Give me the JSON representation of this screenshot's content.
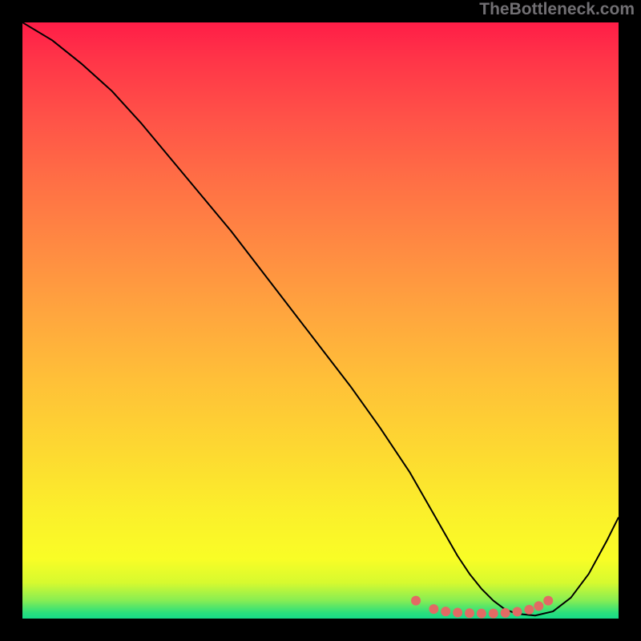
{
  "watermark": "TheBottleneck.com",
  "chart_data": {
    "type": "line",
    "title": "",
    "xlabel": "",
    "ylabel": "",
    "xlim": [
      0,
      100
    ],
    "ylim": [
      0,
      100
    ],
    "grid": false,
    "series": [
      {
        "name": "bottleneck-curve",
        "color": "#000000",
        "x": [
          0,
          5,
          10,
          15,
          20,
          25,
          30,
          35,
          40,
          45,
          50,
          55,
          60,
          65,
          67,
          69,
          71,
          73,
          75,
          77,
          79,
          81,
          83,
          86,
          89,
          92,
          95,
          98,
          100
        ],
        "values": [
          100,
          97,
          93,
          88.5,
          83,
          77,
          71,
          65,
          58.5,
          52,
          45.5,
          39,
          32,
          24.5,
          21,
          17.5,
          14,
          10.5,
          7.5,
          5,
          3,
          1.5,
          0.8,
          0.5,
          1.2,
          3.5,
          7.5,
          13,
          17
        ]
      }
    ],
    "markers": {
      "name": "bottom-dots",
      "color": "#e26a64",
      "radius": 6,
      "x": [
        66,
        69,
        71,
        73,
        75,
        77,
        79,
        81,
        83,
        85,
        86.6,
        88.2
      ],
      "values": [
        3.0,
        1.6,
        1.2,
        1.0,
        0.9,
        0.85,
        0.85,
        0.95,
        1.15,
        1.5,
        2.1,
        3.0
      ]
    },
    "background": {
      "type": "vertical-gradient",
      "stops": [
        {
          "pos": 0.0,
          "color": "#ff1d47"
        },
        {
          "pos": 0.5,
          "color": "#ffa63e"
        },
        {
          "pos": 0.82,
          "color": "#fbef2b"
        },
        {
          "pos": 0.97,
          "color": "#86ed54"
        },
        {
          "pos": 1.0,
          "color": "#17da89"
        }
      ]
    }
  }
}
